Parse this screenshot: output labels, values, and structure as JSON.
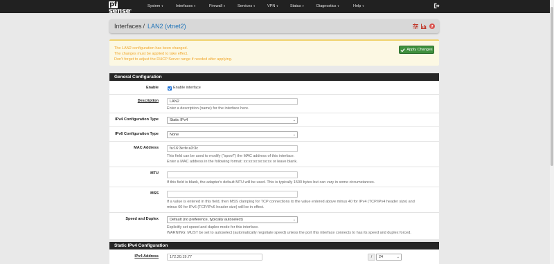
{
  "navbar": {
    "logo_main": "sense",
    "logo_pf": "pf",
    "logo_sub": "COMMUNITY EDITION",
    "menu": [
      {
        "label": "System"
      },
      {
        "label": "Interfaces"
      },
      {
        "label": "Firewall"
      },
      {
        "label": "Services"
      },
      {
        "label": "VPN"
      },
      {
        "label": "Status"
      },
      {
        "label": "Diagnostics"
      },
      {
        "label": "Help"
      }
    ],
    "logout_icon": "sign-out-icon"
  },
  "breadcrumb": {
    "section": "Interfaces",
    "separator": "/",
    "current": "LAN2 (vtnet2)",
    "icons": [
      "sliders-icon",
      "chart-icon",
      "help-icon"
    ]
  },
  "alert": {
    "line1": "The LAN2 configuration has been changed.",
    "line2": "The changes must be applied to take effect.",
    "line3": "Don't forget to adjust the DHCP Server range if needed after applying.",
    "apply_label": "Apply Changes",
    "colors": {
      "text": "#f0a72c",
      "background": "#fcf8e3",
      "button": "#3f8f3e"
    }
  },
  "general": {
    "title": "General Configuration",
    "enable": {
      "label": "Enable",
      "checkbox_label": "Enable interface",
      "checked": true
    },
    "description": {
      "label": "Description",
      "value": "LAN2",
      "help": "Enter a description (name) for the interface here."
    },
    "ipv4_type": {
      "label": "IPv4 Configuration Type",
      "value": "Static IPv4"
    },
    "ipv6_type": {
      "label": "IPv6 Configuration Type",
      "value": "None"
    },
    "mac": {
      "label": "MAC Address",
      "value": "fa:16:3e:fe:a3:3c",
      "help1": "This field can be used to modify (\"spoof\") the MAC address of this interface.",
      "help2": "Enter a MAC address in the following format: xx:xx:xx:xx:xx:xx or leave blank."
    },
    "mtu": {
      "label": "MTU",
      "value": "",
      "help": "If this field is blank, the adapter's default MTU will be used. This is typically 1500 bytes but can vary in some circumstances."
    },
    "mss": {
      "label": "MSS",
      "value": "",
      "help1": "If a value is entered in this field, then MSS clamping for TCP connections to the value entered above minus 40 for IPv4 (TCP/IPv4 header size) and",
      "help2": "minus 60 for IPv6 (TCP/IPv6 header size) will be in effect."
    },
    "speed": {
      "label": "Speed and Duplex",
      "value": "Default (no preference, typically autoselect)",
      "help1": "Explicitly set speed and duplex mode for this interface.",
      "help2": "WARNING: MUST be set to autoselect (automatically negotiate speed) unless the port this interface connects to has its speed and duplex forced."
    }
  },
  "static_ipv4": {
    "title": "Static IPv4 Configuration",
    "address": {
      "label": "IPv4 Address",
      "value": "172.20.19.77",
      "slash": "/",
      "cidr": "24"
    }
  }
}
